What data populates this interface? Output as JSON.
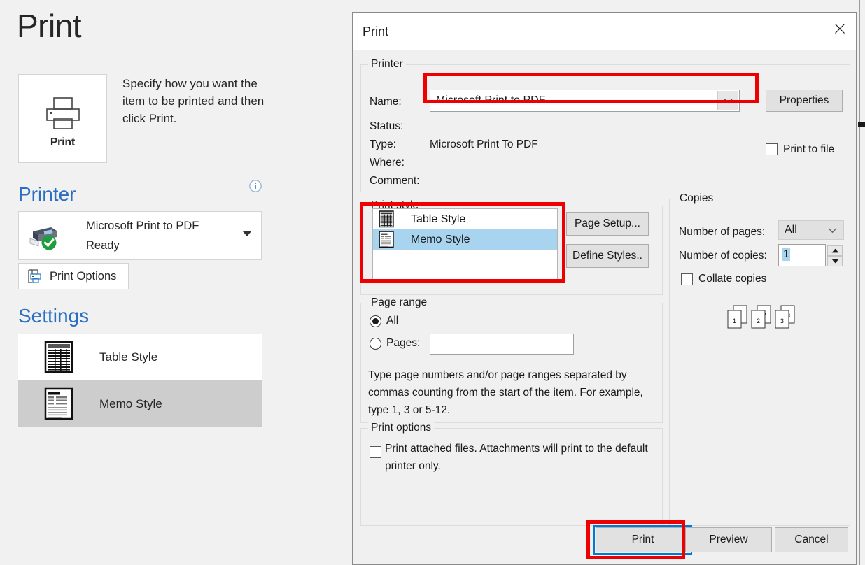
{
  "backstage": {
    "title": "Print",
    "print_tile": {
      "label": "Print",
      "icon": "printer-icon"
    },
    "description": "Specify how you want the item to be printed and then click Print.",
    "printer_section": {
      "heading": "Printer",
      "info_icon": "info-icon",
      "selected_printer": "Microsoft Print to PDF",
      "status": "Ready",
      "print_options_button": "Print Options"
    },
    "settings_section": {
      "heading": "Settings",
      "items": [
        {
          "label": "Table Style",
          "selected": false,
          "icon": "table-style-icon"
        },
        {
          "label": "Memo Style",
          "selected": true,
          "icon": "memo-style-icon"
        }
      ]
    }
  },
  "dialog": {
    "title": "Print",
    "close_icon": "close-icon",
    "printer_group": {
      "legend": "Printer",
      "name_label": "Name:",
      "name_value": "Microsoft Print to PDF",
      "status_label": "Status:",
      "status_value": "",
      "type_label": "Type:",
      "type_value": "Microsoft Print To PDF",
      "where_label": "Where:",
      "where_value": "",
      "comment_label": "Comment:",
      "comment_value": "",
      "properties_button": "Properties",
      "print_to_file_label": "Print to file",
      "print_to_file_checked": false
    },
    "print_style_group": {
      "legend": "Print style",
      "items": [
        {
          "label": "Table Style",
          "selected": false,
          "icon": "table-style-icon"
        },
        {
          "label": "Memo Style",
          "selected": true,
          "icon": "memo-style-icon"
        }
      ],
      "page_setup_button": "Page Setup...",
      "define_styles_button": "Define Styles.."
    },
    "copies_group": {
      "legend": "Copies",
      "number_of_pages_label": "Number of pages:",
      "number_of_pages_value": "All",
      "number_of_copies_label": "Number of copies:",
      "number_of_copies_value": "1",
      "collate_label": "Collate copies",
      "collate_checked": false,
      "collate_preview_numbers": [
        "1",
        "1",
        "2",
        "2",
        "3",
        "3"
      ]
    },
    "page_range_group": {
      "legend": "Page range",
      "all_label": "All",
      "all_selected": true,
      "pages_label": "Pages:",
      "pages_selected": false,
      "pages_value": "",
      "hint": "Type page numbers and/or page ranges separated by commas counting from the start of the item.  For example, type 1, 3 or 5-12."
    },
    "print_options_group": {
      "legend": "Print options",
      "attachments_label": "Print attached files.  Attachments will print to the default printer only.",
      "attachments_checked": false
    },
    "footer": {
      "print_button": "Print",
      "preview_button": "Preview",
      "cancel_button": "Cancel"
    }
  },
  "annotations": {
    "highlight_color": "#ef0000",
    "focus_color": "#0078d7"
  }
}
